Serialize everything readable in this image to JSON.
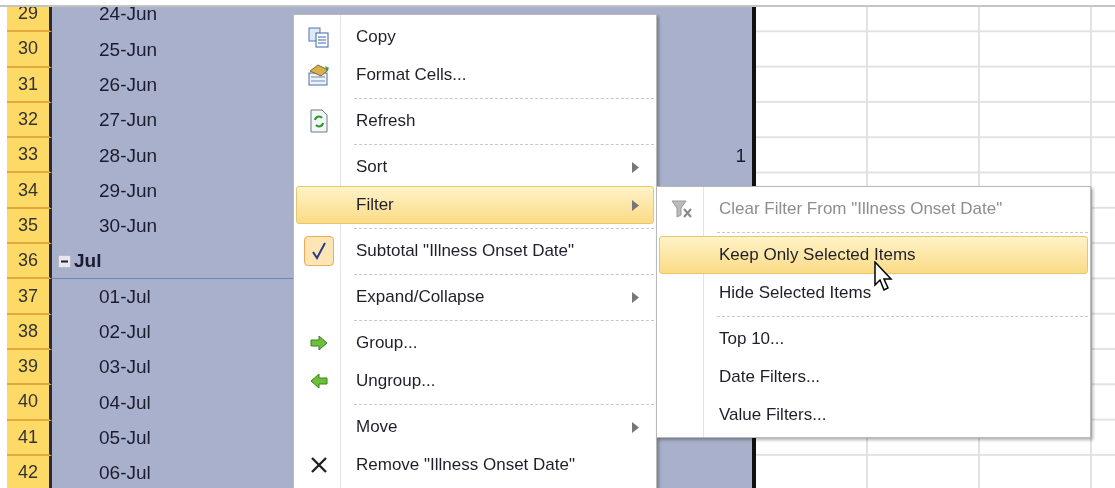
{
  "rows": [
    {
      "number": "29",
      "kind": "date",
      "label": "24-Jun"
    },
    {
      "number": "30",
      "kind": "date",
      "label": "25-Jun"
    },
    {
      "number": "31",
      "kind": "date",
      "label": "26-Jun"
    },
    {
      "number": "32",
      "kind": "date",
      "label": "27-Jun"
    },
    {
      "number": "33",
      "kind": "date",
      "label": "28-Jun",
      "value": "1"
    },
    {
      "number": "34",
      "kind": "date",
      "label": "29-Jun"
    },
    {
      "number": "35",
      "kind": "date",
      "label": "30-Jun"
    },
    {
      "number": "36",
      "kind": "group",
      "label": "Jul",
      "expanded": true
    },
    {
      "number": "37",
      "kind": "date",
      "label": "01-Jul"
    },
    {
      "number": "38",
      "kind": "date",
      "label": "02-Jul"
    },
    {
      "number": "39",
      "kind": "date",
      "label": "03-Jul"
    },
    {
      "number": "40",
      "kind": "date",
      "label": "04-Jul"
    },
    {
      "number": "41",
      "kind": "date",
      "label": "05-Jul"
    },
    {
      "number": "42",
      "kind": "date",
      "label": "06-Jul"
    }
  ],
  "context_menu": [
    {
      "kind": "item",
      "label": "Copy",
      "submenu": false,
      "selected": false,
      "checked": false
    },
    {
      "kind": "item",
      "label": "Format Cells...",
      "submenu": false,
      "selected": false,
      "checked": false
    },
    {
      "kind": "separator"
    },
    {
      "kind": "item",
      "label": "Refresh",
      "submenu": false,
      "selected": false,
      "checked": false
    },
    {
      "kind": "separator"
    },
    {
      "kind": "item",
      "label": "Sort",
      "submenu": true,
      "selected": false,
      "checked": false
    },
    {
      "kind": "item",
      "label": "Filter",
      "submenu": true,
      "selected": true,
      "checked": false
    },
    {
      "kind": "separator"
    },
    {
      "kind": "item",
      "label": "Subtotal \"Illness Onset Date\"",
      "submenu": false,
      "selected": false,
      "checked": true
    },
    {
      "kind": "separator"
    },
    {
      "kind": "item",
      "label": "Expand/Collapse",
      "submenu": true,
      "selected": false,
      "checked": false
    },
    {
      "kind": "separator"
    },
    {
      "kind": "item",
      "label": "Group...",
      "submenu": false,
      "selected": false,
      "checked": false
    },
    {
      "kind": "item",
      "label": "Ungroup...",
      "submenu": false,
      "selected": false,
      "checked": false
    },
    {
      "kind": "separator"
    },
    {
      "kind": "item",
      "label": "Move",
      "submenu": true,
      "selected": false,
      "checked": false
    },
    {
      "kind": "item",
      "label": "Remove \"Illness Onset Date\"",
      "submenu": false,
      "selected": false,
      "checked": false
    }
  ],
  "filter_submenu": [
    {
      "kind": "item",
      "label": "Clear Filter From \"Illness Onset Date\"",
      "disabled": true,
      "selected": false
    },
    {
      "kind": "separator"
    },
    {
      "kind": "item",
      "label": "Keep Only Selected Items",
      "disabled": false,
      "selected": true
    },
    {
      "kind": "item",
      "label": "Hide Selected Items",
      "disabled": false,
      "selected": false
    },
    {
      "kind": "separator"
    },
    {
      "kind": "item",
      "label": "Top 10...",
      "disabled": false,
      "selected": false
    },
    {
      "kind": "item",
      "label": "Date Filters...",
      "disabled": false,
      "selected": false
    },
    {
      "kind": "item",
      "label": "Value Filters...",
      "disabled": false,
      "selected": false
    }
  ]
}
